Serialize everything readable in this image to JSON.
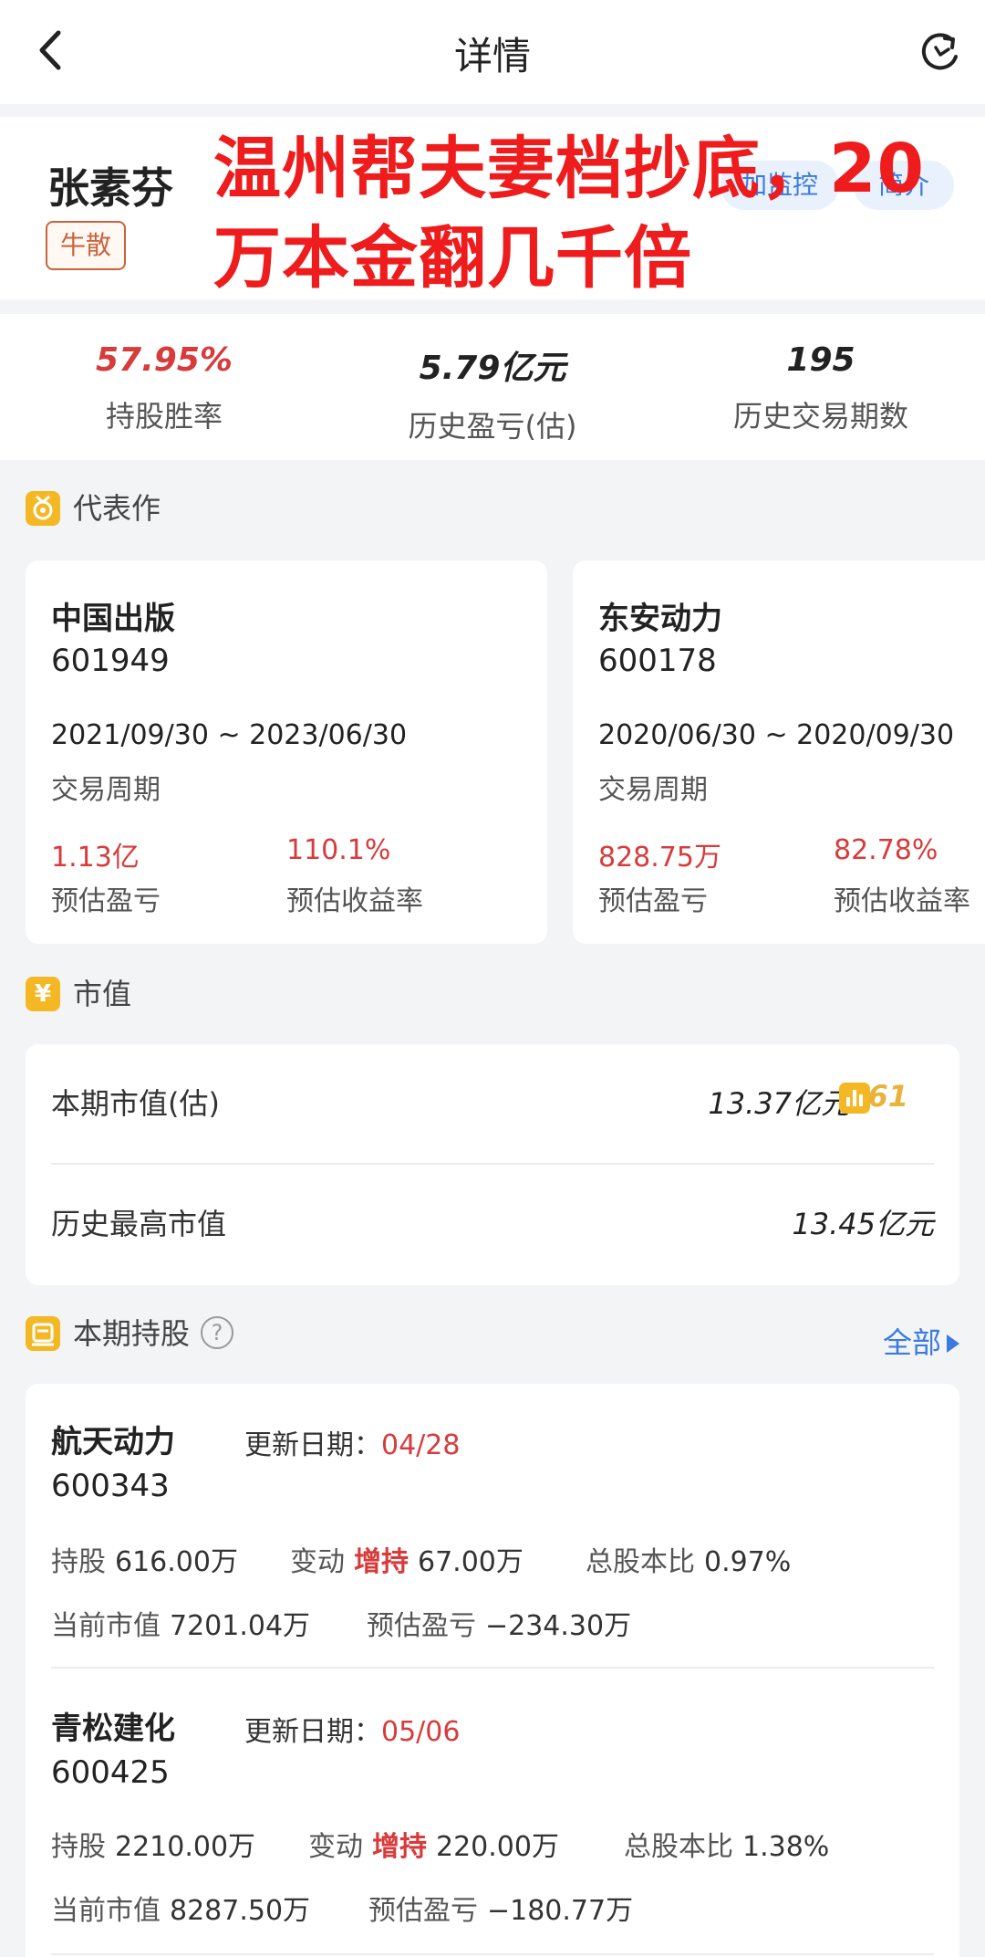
{
  "header": {
    "title": "详情"
  },
  "profile": {
    "name": "张素芬",
    "tag": "牛散",
    "monitor_label": "加监控",
    "intro_label": "简介",
    "overlay_text": "温州帮夫妻档抄底，20万本金翻几千倍"
  },
  "stats": [
    {
      "value": "57.95%",
      "label": "持股胜率"
    },
    {
      "value": "5.79亿元",
      "label": "历史盈亏(估)"
    },
    {
      "value": "195",
      "label": "历史交易期数"
    }
  ],
  "works": {
    "title": "代表作",
    "items": [
      {
        "name": "中国出版",
        "code": "601949",
        "period": "2021/09/30 ~ 2023/06/30",
        "period_label": "交易周期",
        "pnl": "1.13亿",
        "pnl_label": "预估盈亏",
        "ret": "110.1%",
        "ret_label": "预估收益率"
      },
      {
        "name": "东安动力",
        "code": "600178",
        "period": "2020/06/30 ~ 2020/09/30",
        "period_label": "交易周期",
        "pnl": "828.75万",
        "pnl_label": "预估盈亏",
        "ret": "82.78%",
        "ret_label": "预估收益率"
      }
    ]
  },
  "market_value": {
    "title": "市值",
    "current_label": "本期市值(估)",
    "current_value": "13.37亿元",
    "rank": "61",
    "max_label": "历史最高市值",
    "max_value": "13.45亿元"
  },
  "holdings": {
    "title": "本期持股",
    "help_icon": "?",
    "all_label": "全部",
    "items": [
      {
        "name": "航天动力",
        "date_label": "更新日期：",
        "date": "04/28",
        "code": "600343",
        "shares_label": "持股",
        "shares": "616.00万",
        "change_label": "变动",
        "change_type": "增持",
        "change": "67.00万",
        "ratio_label": "总股本比",
        "ratio": "0.97%",
        "mv_label": "当前市值",
        "mv": "7201.04万",
        "pnl_label": "预估盈亏",
        "pnl": "−234.30万"
      },
      {
        "name": "青松建化",
        "date_label": "更新日期：",
        "date": "05/06",
        "code": "600425",
        "shares_label": "持股",
        "shares": "2210.00万",
        "change_label": "变动",
        "change_type": "增持",
        "change": "220.00万",
        "ratio_label": "总股本比",
        "ratio": "1.38%",
        "mv_label": "当前市值",
        "mv": "8287.50万",
        "pnl_label": "预估盈亏",
        "pnl": "−180.77万"
      }
    ]
  },
  "colors": {
    "accent_red": "#d83b3b",
    "link_blue": "#3a7ae0",
    "tag_orange": "#c9643f",
    "icon_gold": "#f5b825",
    "overlay_red": "#ee1c1c"
  },
  "icons": {
    "back": "chevron-left-icon",
    "refresh": "refresh-icon",
    "works": "medal-icon",
    "market": "yuan-icon",
    "holdings": "portfolio-icon",
    "rank": "bar-chart-icon"
  }
}
